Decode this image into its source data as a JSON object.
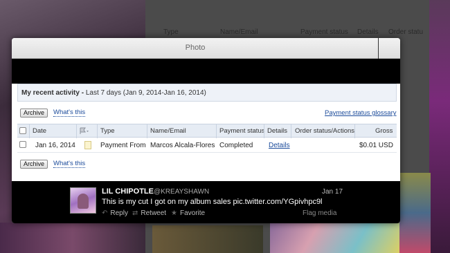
{
  "background": {
    "col_type": "Type",
    "col_name_email": "Name/Email",
    "col_payment_status": "Payment status",
    "col_details": "Details",
    "col_order_status": "Order statu"
  },
  "lightbox": {
    "title": "Photo"
  },
  "activity": {
    "heading_bold": "My recent activity -",
    "heading_range": "Last 7 days (Jan 9, 2014-Jan 16, 2014)",
    "archive_label": "Archive",
    "whats_this_label": "What's this",
    "glossary_label": "Payment status glossary",
    "columns": {
      "date": "Date",
      "type": "Type",
      "name_email": "Name/Email",
      "payment_status": "Payment status",
      "details": "Details",
      "order_status": "Order status/Actions",
      "gross": "Gross"
    },
    "rows": [
      {
        "date": "Jan 16, 2014",
        "type": "Payment From",
        "name": "Marcos Alcala-Flores",
        "payment_status": "Completed",
        "details": "Details",
        "order_status": "",
        "gross": "$0.01 USD"
      }
    ]
  },
  "tweet": {
    "name": "LIL CHIPOTLE",
    "handle": "@KREAYSHAWN",
    "date": "Jan 17",
    "text": "This is my cut I got on my album sales pic.twitter.com/YGpivhpc9l",
    "actions": {
      "reply": "Reply",
      "retweet": "Retweet",
      "favorite": "Favorite",
      "flag": "Flag media"
    }
  },
  "colors": {
    "link": "#1a4a9a",
    "header_bg": "#eef2f8",
    "lightbox_black": "#000000"
  }
}
